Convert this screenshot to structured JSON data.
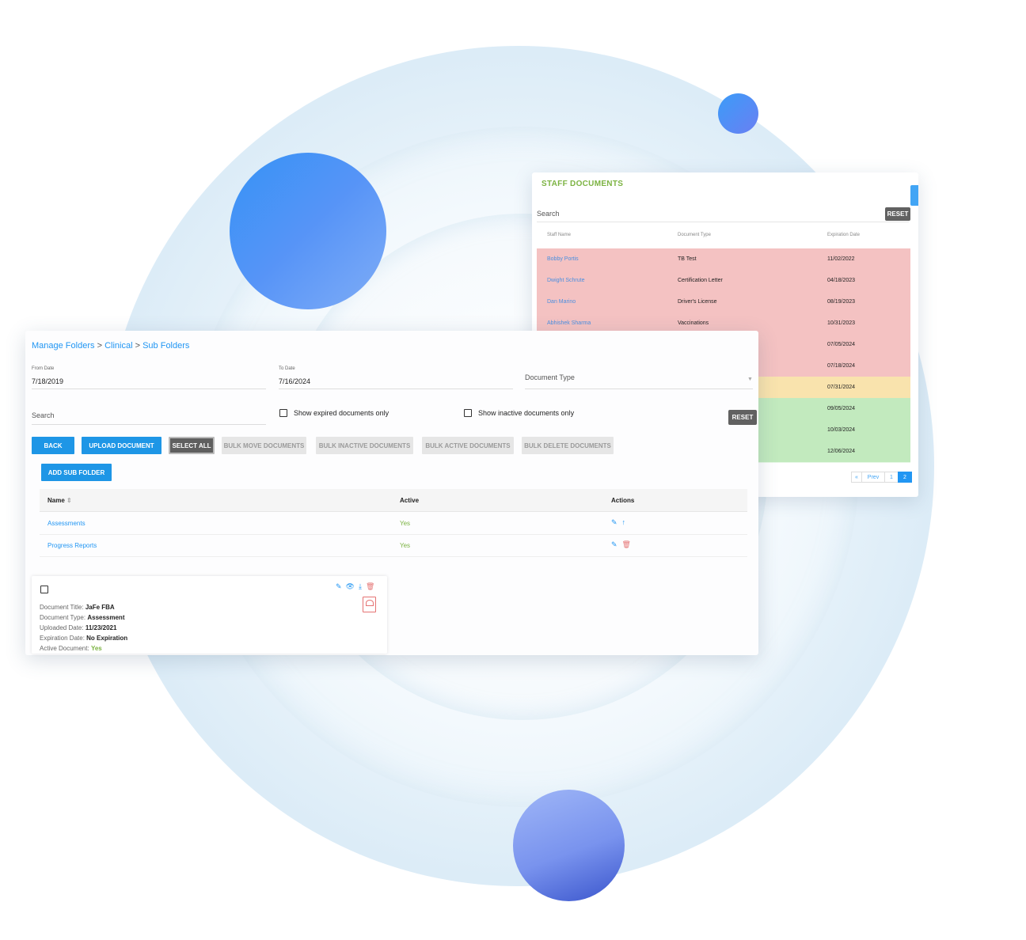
{
  "staff_documents": {
    "title": "STAFF DOCUMENTS",
    "search_label": "Search",
    "reset_label": "RESET",
    "columns": [
      "Staff Name",
      "Document Type",
      "Expiration Date"
    ],
    "rows": [
      {
        "name": "Bobby Portis",
        "type": "TB Test",
        "date": "11/02/2022",
        "status_color": "#f4c2c2"
      },
      {
        "name": "Dwight Schrute",
        "type": "Certification Letter",
        "date": "04/18/2023",
        "status_color": "#f4c2c2"
      },
      {
        "name": "Dan Marino",
        "type": "Driver's License",
        "date": "08/19/2023",
        "status_color": "#f4c2c2"
      },
      {
        "name": "Abhishek Sharma",
        "type": "Vaccinations",
        "date": "10/31/2023",
        "status_color": "#f4c2c2"
      },
      {
        "name": "",
        "type": "",
        "date": "07/05/2024",
        "status_color": "#f4c2c2"
      },
      {
        "name": "",
        "type": "",
        "date": "07/18/2024",
        "status_color": "#f4c2c2"
      },
      {
        "name": "",
        "type": "",
        "date": "07/31/2024",
        "status_color": "#f9e3ad"
      },
      {
        "name": "",
        "type": "",
        "date": "09/05/2024",
        "status_color": "#c2eabe"
      },
      {
        "name": "",
        "type": "",
        "date": "10/03/2024",
        "status_color": "#c2eabe"
      },
      {
        "name": "",
        "type": "",
        "date": "12/06/2024",
        "status_color": "#c2eabe"
      }
    ],
    "pagination": {
      "first": "«",
      "prev": "Prev",
      "pages": [
        "1",
        "2"
      ],
      "current": "2"
    }
  },
  "folders": {
    "breadcrumb": [
      "Manage Folders",
      "Clinical",
      "Sub Folders"
    ],
    "breadcrumb_sep": ">",
    "from_date_label": "From Date",
    "from_date": "7/18/2019",
    "to_date_label": "To Date",
    "to_date": "7/16/2024",
    "document_type_label": "Document Type",
    "search_label": "Search",
    "show_expired_label": "Show expired documents only",
    "show_inactive_label": "Show inactive documents only",
    "reset_label": "RESET",
    "buttons": {
      "back": "BACK",
      "upload": "UPLOAD DOCUMENT",
      "select_all": "SELECT ALL",
      "bulk_move": "BULK MOVE DOCUMENTS",
      "bulk_inactive": "BULK INACTIVE DOCUMENTS",
      "bulk_active": "BULK ACTIVE DOCUMENTS",
      "bulk_delete": "BULK DELETE DOCUMENTS",
      "add_sub_folder": "ADD SUB FOLDER"
    },
    "table": {
      "headers": {
        "name": "Name",
        "active": "Active",
        "actions": "Actions"
      },
      "rows": [
        {
          "name": "Assessments",
          "active": "Yes"
        },
        {
          "name": "Progress Reports",
          "active": "Yes"
        }
      ]
    },
    "document_card": {
      "title_label": "Document Title:",
      "title": "JaFe FBA",
      "type_label": "Document Type:",
      "type": "Assessment",
      "uploaded_label": "Uploaded Date:",
      "uploaded": "11/23/2021",
      "expiration_label": "Expiration Date:",
      "expiration": "No Expiration",
      "active_label": "Active Document:",
      "active": "Yes"
    }
  },
  "colors": {
    "accent_blue": "#1e96e6",
    "title_green": "#7cb342",
    "expired_red": "#f4c2c2",
    "warning_yellow": "#f9e3ad",
    "valid_green": "#c2eabe"
  }
}
